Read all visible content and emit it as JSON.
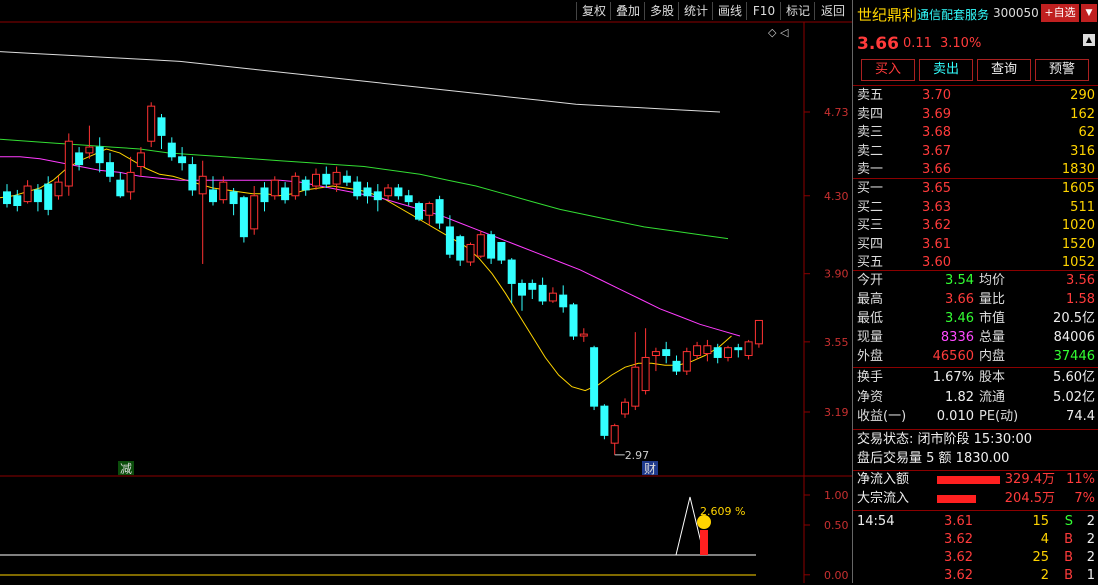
{
  "toolbar": {
    "items": [
      "复权",
      "叠加",
      "多股",
      "统计",
      "画线",
      "F10",
      "标记",
      "返回"
    ]
  },
  "chart": {
    "price_labels": [
      "4.73",
      "4.30",
      "3.90",
      "3.55",
      "3.19"
    ],
    "ind_labels": [
      "1.00",
      "0.50",
      "0.00"
    ],
    "low_annotation": "2.97",
    "marker_jian": "减",
    "marker_cai": "财",
    "indicator_value": "2.609 %",
    "corner_icons": "◇ ◁"
  },
  "chart_data": {
    "type": "candlestick",
    "y_ticks": [
      4.73,
      4.3,
      3.9,
      3.55,
      3.19
    ],
    "candles": [
      {
        "o": 4.32,
        "c": 4.26,
        "h": 4.36,
        "l": 4.24
      },
      {
        "o": 4.3,
        "c": 4.25,
        "h": 4.33,
        "l": 4.22
      },
      {
        "o": 4.27,
        "c": 4.35,
        "h": 4.38,
        "l": 4.26
      },
      {
        "o": 4.33,
        "c": 4.27,
        "h": 4.36,
        "l": 4.22
      },
      {
        "o": 4.36,
        "c": 4.23,
        "h": 4.4,
        "l": 4.2
      },
      {
        "o": 4.3,
        "c": 4.37,
        "h": 4.4,
        "l": 4.28
      },
      {
        "o": 4.35,
        "c": 4.58,
        "h": 4.62,
        "l": 4.3
      },
      {
        "o": 4.52,
        "c": 4.46,
        "h": 4.55,
        "l": 4.43
      },
      {
        "o": 4.52,
        "c": 4.55,
        "h": 4.66,
        "l": 4.49
      },
      {
        "o": 4.55,
        "c": 4.47,
        "h": 4.6,
        "l": 4.42
      },
      {
        "o": 4.47,
        "c": 4.4,
        "h": 4.52,
        "l": 4.37
      },
      {
        "o": 4.38,
        "c": 4.3,
        "h": 4.42,
        "l": 4.29
      },
      {
        "o": 4.32,
        "c": 4.42,
        "h": 4.5,
        "l": 4.28
      },
      {
        "o": 4.45,
        "c": 4.52,
        "h": 4.55,
        "l": 4.4
      },
      {
        "o": 4.58,
        "c": 4.76,
        "h": 4.78,
        "l": 4.55
      },
      {
        "o": 4.7,
        "c": 4.61,
        "h": 4.72,
        "l": 4.54
      },
      {
        "o": 4.57,
        "c": 4.5,
        "h": 4.6,
        "l": 4.48
      },
      {
        "o": 4.5,
        "c": 4.47,
        "h": 4.55,
        "l": 4.43
      },
      {
        "o": 4.46,
        "c": 4.33,
        "h": 4.5,
        "l": 4.3
      },
      {
        "o": 4.31,
        "c": 4.4,
        "h": 4.48,
        "l": 3.95
      },
      {
        "o": 4.33,
        "c": 4.27,
        "h": 4.4,
        "l": 4.25
      },
      {
        "o": 4.28,
        "c": 4.37,
        "h": 4.4,
        "l": 4.26
      },
      {
        "o": 4.32,
        "c": 4.26,
        "h": 4.34,
        "l": 4.2
      },
      {
        "o": 4.29,
        "c": 4.09,
        "h": 4.3,
        "l": 4.06
      },
      {
        "o": 4.13,
        "c": 4.3,
        "h": 4.35,
        "l": 4.1
      },
      {
        "o": 4.34,
        "c": 4.27,
        "h": 4.37,
        "l": 4.22
      },
      {
        "o": 4.3,
        "c": 4.38,
        "h": 4.4,
        "l": 4.28
      },
      {
        "o": 4.34,
        "c": 4.28,
        "h": 4.37,
        "l": 4.26
      },
      {
        "o": 4.3,
        "c": 4.4,
        "h": 4.42,
        "l": 4.28
      },
      {
        "o": 4.38,
        "c": 4.33,
        "h": 4.4,
        "l": 4.3
      },
      {
        "o": 4.35,
        "c": 4.41,
        "h": 4.44,
        "l": 4.33
      },
      {
        "o": 4.41,
        "c": 4.36,
        "h": 4.45,
        "l": 4.34
      },
      {
        "o": 4.36,
        "c": 4.42,
        "h": 4.45,
        "l": 4.32
      },
      {
        "o": 4.4,
        "c": 4.37,
        "h": 4.43,
        "l": 4.35
      },
      {
        "o": 4.37,
        "c": 4.3,
        "h": 4.4,
        "l": 4.28
      },
      {
        "o": 4.34,
        "c": 4.3,
        "h": 4.37,
        "l": 4.26
      },
      {
        "o": 4.32,
        "c": 4.28,
        "h": 4.36,
        "l": 4.22
      },
      {
        "o": 4.3,
        "c": 4.34,
        "h": 4.36,
        "l": 4.28
      },
      {
        "o": 4.34,
        "c": 4.3,
        "h": 4.36,
        "l": 4.28
      },
      {
        "o": 4.3,
        "c": 4.27,
        "h": 4.33,
        "l": 4.25
      },
      {
        "o": 4.26,
        "c": 4.18,
        "h": 4.27,
        "l": 4.17
      },
      {
        "o": 4.2,
        "c": 4.26,
        "h": 4.27,
        "l": 4.15
      },
      {
        "o": 4.28,
        "c": 4.16,
        "h": 4.3,
        "l": 4.13
      },
      {
        "o": 4.14,
        "c": 4.0,
        "h": 4.2,
        "l": 3.98
      },
      {
        "o": 4.09,
        "c": 3.97,
        "h": 4.1,
        "l": 3.94
      },
      {
        "o": 3.96,
        "c": 4.05,
        "h": 4.06,
        "l": 3.94
      },
      {
        "o": 3.99,
        "c": 4.1,
        "h": 4.12,
        "l": 3.98
      },
      {
        "o": 4.1,
        "c": 3.98,
        "h": 4.12,
        "l": 3.95
      },
      {
        "o": 4.06,
        "c": 3.97,
        "h": 4.06,
        "l": 3.95
      },
      {
        "o": 3.97,
        "c": 3.85,
        "h": 3.98,
        "l": 3.75
      },
      {
        "o": 3.85,
        "c": 3.79,
        "h": 3.87,
        "l": 3.71
      },
      {
        "o": 3.85,
        "c": 3.82,
        "h": 3.87,
        "l": 3.77
      },
      {
        "o": 3.84,
        "c": 3.76,
        "h": 3.88,
        "l": 3.74
      },
      {
        "o": 3.76,
        "c": 3.8,
        "h": 3.83,
        "l": 3.75
      },
      {
        "o": 3.79,
        "c": 3.73,
        "h": 3.84,
        "l": 3.7
      },
      {
        "o": 3.74,
        "c": 3.58,
        "h": 3.75,
        "l": 3.56
      },
      {
        "o": 3.58,
        "c": 3.59,
        "h": 3.62,
        "l": 3.55
      },
      {
        "o": 3.52,
        "c": 3.22,
        "h": 3.53,
        "l": 3.2
      },
      {
        "o": 3.22,
        "c": 3.07,
        "h": 3.23,
        "l": 3.05
      },
      {
        "o": 3.03,
        "c": 3.12,
        "h": 3.13,
        "l": 2.97
      },
      {
        "o": 3.18,
        "c": 3.24,
        "h": 3.26,
        "l": 3.16
      },
      {
        "o": 3.22,
        "c": 3.42,
        "h": 3.6,
        "l": 3.2
      },
      {
        "o": 3.3,
        "c": 3.47,
        "h": 3.62,
        "l": 3.28
      },
      {
        "o": 3.48,
        "c": 3.5,
        "h": 3.52,
        "l": 3.4
      },
      {
        "o": 3.51,
        "c": 3.48,
        "h": 3.55,
        "l": 3.44
      },
      {
        "o": 3.45,
        "c": 3.4,
        "h": 3.48,
        "l": 3.38
      },
      {
        "o": 3.4,
        "c": 3.5,
        "h": 3.52,
        "l": 3.38
      },
      {
        "o": 3.48,
        "c": 3.53,
        "h": 3.55,
        "l": 3.46
      },
      {
        "o": 3.49,
        "c": 3.53,
        "h": 3.56,
        "l": 3.45
      },
      {
        "o": 3.52,
        "c": 3.47,
        "h": 3.54,
        "l": 3.44
      },
      {
        "o": 3.47,
        "c": 3.52,
        "h": 3.53,
        "l": 3.45
      },
      {
        "o": 3.52,
        "c": 3.51,
        "h": 3.54,
        "l": 3.47
      },
      {
        "o": 3.48,
        "c": 3.55,
        "h": 3.56,
        "l": 3.46
      },
      {
        "o": 3.54,
        "c": 3.66,
        "h": 3.66,
        "l": 3.52
      }
    ],
    "ma_lines": [
      {
        "color": "#ffd400",
        "values": [
          4.29,
          4.3,
          4.32,
          4.34,
          4.38,
          4.44,
          4.48,
          4.51,
          4.54,
          4.52,
          4.48,
          4.44,
          4.41,
          4.4,
          4.38,
          4.36,
          4.34,
          4.33,
          4.32,
          4.31,
          4.31,
          4.3,
          4.31,
          4.33,
          4.34,
          4.35,
          4.34,
          4.33,
          4.31,
          4.28,
          4.24,
          4.2,
          4.16,
          4.12,
          4.08,
          4.04,
          3.98,
          3.9,
          3.8,
          3.69,
          3.58,
          3.47,
          3.38,
          3.32,
          3.3,
          3.33,
          3.38,
          3.42,
          3.44,
          3.44,
          3.43,
          3.43,
          3.45,
          3.48,
          3.52,
          3.58
        ]
      },
      {
        "color": "#ff3cff",
        "values": [
          4.5,
          4.5,
          4.49,
          4.47,
          4.45,
          4.43,
          4.42,
          4.4,
          4.39,
          4.38,
          4.38,
          4.38,
          4.38,
          4.38,
          4.38,
          4.37,
          4.35,
          4.33,
          4.31,
          4.29,
          4.26,
          4.23,
          4.2,
          4.16,
          4.12,
          4.08,
          4.04,
          4.0,
          3.96,
          3.92,
          3.87,
          3.82,
          3.77,
          3.72,
          3.68,
          3.64,
          3.61,
          3.58
        ]
      },
      {
        "color": "#33dd33",
        "values": [
          4.59,
          4.58,
          4.57,
          4.56,
          4.55,
          4.54,
          4.52,
          4.51,
          4.5,
          4.49,
          4.48,
          4.47,
          4.46,
          4.45,
          4.43,
          4.41,
          4.38,
          4.35,
          4.31,
          4.27,
          4.23,
          4.2,
          4.17,
          4.14,
          4.12,
          4.1,
          4.08
        ]
      },
      {
        "color": "#dddddd",
        "values": [
          5.04,
          5.03,
          5.02,
          5.01,
          5.0,
          4.99,
          4.97,
          4.95,
          4.93,
          4.91,
          4.89,
          4.87,
          4.85,
          4.83,
          4.81,
          4.79,
          4.77,
          4.76,
          4.75,
          4.74,
          4.73
        ]
      }
    ]
  },
  "panel": {
    "stock_name": "世纪鼎利",
    "service": "通信配套服务",
    "code": "300050",
    "add_btn": "+自选",
    "price": "3.66",
    "change": "0.11",
    "pct": "3.10%",
    "buttons": [
      "买入",
      "卖出",
      "查询",
      "预警"
    ],
    "asks": [
      {
        "label": "卖五",
        "price": "3.70",
        "vol": "290"
      },
      {
        "label": "卖四",
        "price": "3.69",
        "vol": "162"
      },
      {
        "label": "卖三",
        "price": "3.68",
        "vol": "62"
      },
      {
        "label": "卖二",
        "price": "3.67",
        "vol": "316"
      },
      {
        "label": "卖一",
        "price": "3.66",
        "vol": "1830"
      }
    ],
    "bids": [
      {
        "label": "买一",
        "price": "3.65",
        "vol": "1605"
      },
      {
        "label": "买二",
        "price": "3.63",
        "vol": "511"
      },
      {
        "label": "买三",
        "price": "3.62",
        "vol": "1020"
      },
      {
        "label": "买四",
        "price": "3.61",
        "vol": "1520"
      },
      {
        "label": "买五",
        "price": "3.60",
        "vol": "1052"
      }
    ],
    "stats1": [
      {
        "l1": "今开",
        "v1": "3.54",
        "c1": "green",
        "l2": "均价",
        "v2": "3.56",
        "c2": "red"
      },
      {
        "l1": "最高",
        "v1": "3.66",
        "c1": "red",
        "l2": "量比",
        "v2": "1.58",
        "c2": "red"
      },
      {
        "l1": "最低",
        "v1": "3.46",
        "c1": "green",
        "l2": "市值",
        "v2": "20.5亿",
        "c2": "white"
      },
      {
        "l1": "现量",
        "v1": "8336",
        "c1": "magenta",
        "l2": "总量",
        "v2": "84006",
        "c2": "white"
      },
      {
        "l1": "外盘",
        "v1": "46560",
        "c1": "red",
        "l2": "内盘",
        "v2": "37446",
        "c2": "green"
      }
    ],
    "stats2": [
      {
        "l1": "换手",
        "v1": "1.67%",
        "l2": "股本",
        "v2": "5.60亿"
      },
      {
        "l1": "净资",
        "v1": "1.82",
        "l2": "流通",
        "v2": "5.02亿"
      },
      {
        "l1": "收益(一)",
        "v1": "0.010",
        "l2": "PE(动)",
        "v2": "74.4"
      }
    ],
    "trade_status": "交易状态: 闭市阶段 15:30:00",
    "after_hours": "盘后交易量 5 额 1830.00",
    "flows": [
      {
        "label": "净流入额",
        "value": "329.4万",
        "pct": "11%",
        "fill": 0.9
      },
      {
        "label": "大宗流入",
        "value": "204.5万",
        "pct": "7%",
        "fill": 0.55
      }
    ],
    "ticks": [
      {
        "time": "14:54",
        "price": "3.61",
        "vol": "15",
        "side": "S",
        "n": "2"
      },
      {
        "time": "",
        "price": "3.62",
        "vol": "4",
        "side": "B",
        "n": "2"
      },
      {
        "time": "",
        "price": "3.62",
        "vol": "25",
        "side": "B",
        "n": "2"
      },
      {
        "time": "",
        "price": "3.62",
        "vol": "2",
        "side": "B",
        "n": "1"
      }
    ]
  }
}
